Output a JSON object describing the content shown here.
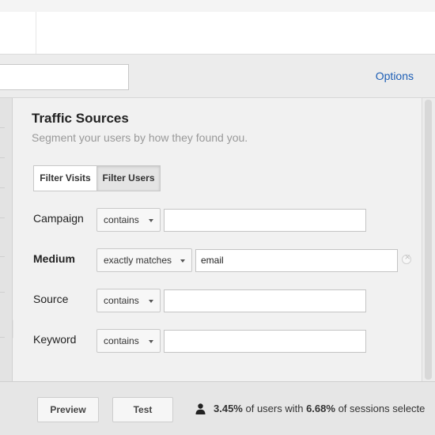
{
  "options_bar": {
    "options_label": "Options"
  },
  "panel": {
    "title": "Traffic Sources",
    "subtitle": "Segment your users by how they found you."
  },
  "filter_tabs": [
    {
      "label": "Filter Visits",
      "selected": false
    },
    {
      "label": "Filter Users",
      "selected": true
    }
  ],
  "rows": {
    "campaign": {
      "label": "Campaign",
      "operator": "contains",
      "value": ""
    },
    "medium": {
      "label": "Medium",
      "operator": "exactly matches",
      "value": "email"
    },
    "source": {
      "label": "Source",
      "operator": "contains",
      "value": ""
    },
    "keyword": {
      "label": "Keyword",
      "operator": "contains",
      "value": ""
    }
  },
  "footer": {
    "preview_label": "Preview",
    "test_label": "Test",
    "users_pct": "3.45%",
    "users_text": " of users with ",
    "sessions_pct": "6.68%",
    "sessions_text": " of sessions selecte"
  },
  "colors": {
    "link": "#1d5eb5"
  }
}
